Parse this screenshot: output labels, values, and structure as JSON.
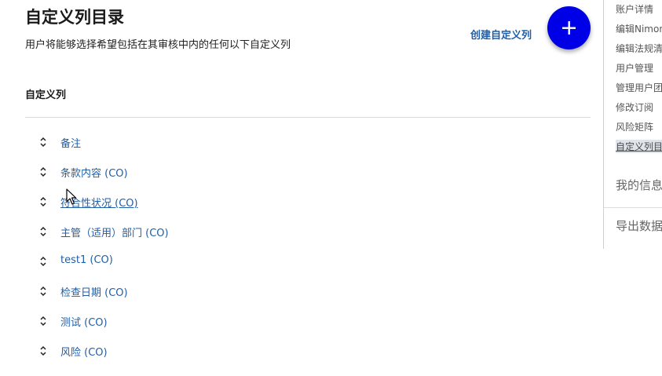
{
  "header": {
    "title": "自定义列目录",
    "subtitle": "用户将能够选择希望包括在其审核中内的任何以下自定义列",
    "create_link": "创建自定义列"
  },
  "section": {
    "label": "自定义列"
  },
  "columns": [
    {
      "label": "备注"
    },
    {
      "label": "条款内容 (CO)"
    },
    {
      "label": "符合性状况 (CO)"
    },
    {
      "label": "主管（适用）部门 (CO)"
    },
    {
      "label": "test1 (CO)"
    },
    {
      "label": "检查日期 (CO)"
    },
    {
      "label": "测试 (CO)"
    },
    {
      "label": "风险 (CO)"
    }
  ],
  "sidenav": {
    "items": [
      {
        "label": "账户详情"
      },
      {
        "label": "编辑Nimon"
      },
      {
        "label": "编辑法规清"
      },
      {
        "label": "用户管理"
      },
      {
        "label": "管理用户团"
      },
      {
        "label": "修改订阅"
      },
      {
        "label": "风险矩阵"
      },
      {
        "label": "自定义列目"
      }
    ],
    "my_info": "我的信息",
    "export": "导出数据"
  },
  "icons": {
    "fab": "plus-icon",
    "row_handle": "sort-arrows-icon",
    "pointer": "mouse-cursor-icon"
  },
  "colors": {
    "fab": "#0000e6",
    "link": "#1f5fa8",
    "active_nav_bg": "#dfe3ea"
  }
}
